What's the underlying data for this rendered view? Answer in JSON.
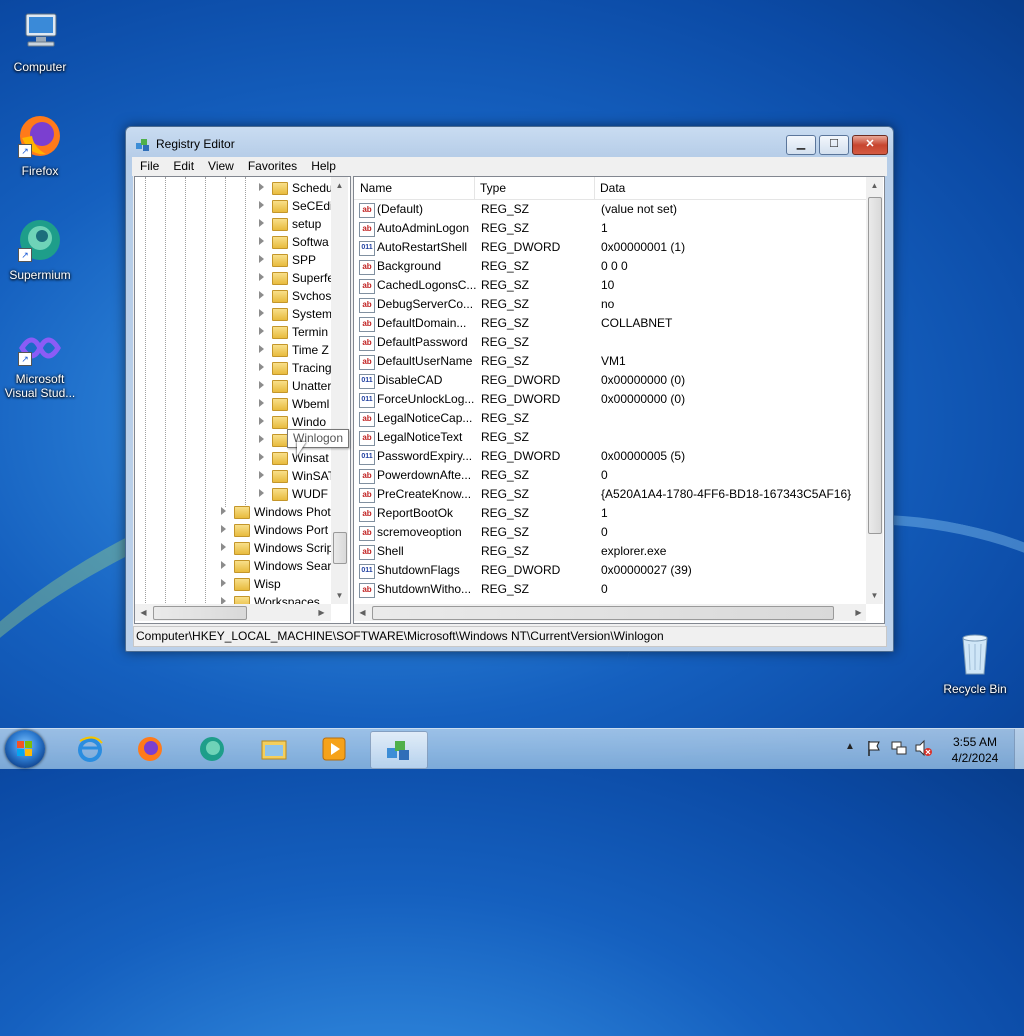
{
  "desktop": {
    "icons": [
      {
        "label": "Computer"
      },
      {
        "label": "Firefox"
      },
      {
        "label": "Supermium"
      },
      {
        "label": "Microsoft Visual Stud..."
      },
      {
        "label": "Recycle Bin"
      }
    ]
  },
  "window": {
    "title": "Registry Editor",
    "menu": [
      "File",
      "Edit",
      "View",
      "Favorites",
      "Help"
    ],
    "tree": {
      "children": [
        "Schedu",
        "SeCEdit",
        "setup",
        "Softwa",
        "SPP",
        "Superfe",
        "Svchos",
        "System",
        "Termin",
        "Time Z",
        "Tracing",
        "Unatter",
        "Wbeml",
        "Windo",
        "Winlogon",
        "Winsat",
        "WinSAT",
        "WUDF"
      ],
      "siblings": [
        "Windows Phot",
        "Windows Port",
        "Windows Scrip",
        "Windows Sear",
        "Wisp",
        "Workspaces"
      ],
      "tooltip": "Winlogon"
    },
    "list": {
      "headers": {
        "name": "Name",
        "type": "Type",
        "data": "Data"
      },
      "rows": [
        {
          "name": "(Default)",
          "type": "REG_SZ",
          "data": "(value not set)",
          "icon": "ab"
        },
        {
          "name": "AutoAdminLogon",
          "type": "REG_SZ",
          "data": "1",
          "icon": "ab"
        },
        {
          "name": "AutoRestartShell",
          "type": "REG_DWORD",
          "data": "0x00000001 (1)",
          "icon": "bin"
        },
        {
          "name": "Background",
          "type": "REG_SZ",
          "data": "0 0 0",
          "icon": "ab"
        },
        {
          "name": "CachedLogonsC...",
          "type": "REG_SZ",
          "data": "10",
          "icon": "ab"
        },
        {
          "name": "DebugServerCo...",
          "type": "REG_SZ",
          "data": "no",
          "icon": "ab"
        },
        {
          "name": "DefaultDomain...",
          "type": "REG_SZ",
          "data": "COLLABNET",
          "icon": "ab"
        },
        {
          "name": "DefaultPassword",
          "type": "REG_SZ",
          "data": "",
          "icon": "ab"
        },
        {
          "name": "DefaultUserName",
          "type": "REG_SZ",
          "data": "VM1",
          "icon": "ab"
        },
        {
          "name": "DisableCAD",
          "type": "REG_DWORD",
          "data": "0x00000000 (0)",
          "icon": "bin"
        },
        {
          "name": "ForceUnlockLog...",
          "type": "REG_DWORD",
          "data": "0x00000000 (0)",
          "icon": "bin"
        },
        {
          "name": "LegalNoticeCap...",
          "type": "REG_SZ",
          "data": "",
          "icon": "ab"
        },
        {
          "name": "LegalNoticeText",
          "type": "REG_SZ",
          "data": "",
          "icon": "ab"
        },
        {
          "name": "PasswordExpiry...",
          "type": "REG_DWORD",
          "data": "0x00000005 (5)",
          "icon": "bin"
        },
        {
          "name": "PowerdownAfte...",
          "type": "REG_SZ",
          "data": "0",
          "icon": "ab"
        },
        {
          "name": "PreCreateKnow...",
          "type": "REG_SZ",
          "data": "{A520A1A4-1780-4FF6-BD18-167343C5AF16}",
          "icon": "ab"
        },
        {
          "name": "ReportBootOk",
          "type": "REG_SZ",
          "data": "1",
          "icon": "ab"
        },
        {
          "name": "scremoveoption",
          "type": "REG_SZ",
          "data": "0",
          "icon": "ab"
        },
        {
          "name": "Shell",
          "type": "REG_SZ",
          "data": "explorer.exe",
          "icon": "ab"
        },
        {
          "name": "ShutdownFlags",
          "type": "REG_DWORD",
          "data": "0x00000027 (39)",
          "icon": "bin"
        },
        {
          "name": "ShutdownWitho...",
          "type": "REG_SZ",
          "data": "0",
          "icon": "ab"
        }
      ]
    },
    "status_path": "Computer\\HKEY_LOCAL_MACHINE\\SOFTWARE\\Microsoft\\Windows NT\\CurrentVersion\\Winlogon"
  },
  "taskbar": {
    "items": [
      "internet-explorer-icon",
      "firefox-icon",
      "supermium-icon",
      "file-explorer-icon",
      "media-player-icon",
      "registry-editor-icon"
    ],
    "time": "3:55 AM",
    "date": "4/2/2024"
  },
  "colors": {
    "accent": "#1560bf",
    "close": "#c7452f"
  }
}
